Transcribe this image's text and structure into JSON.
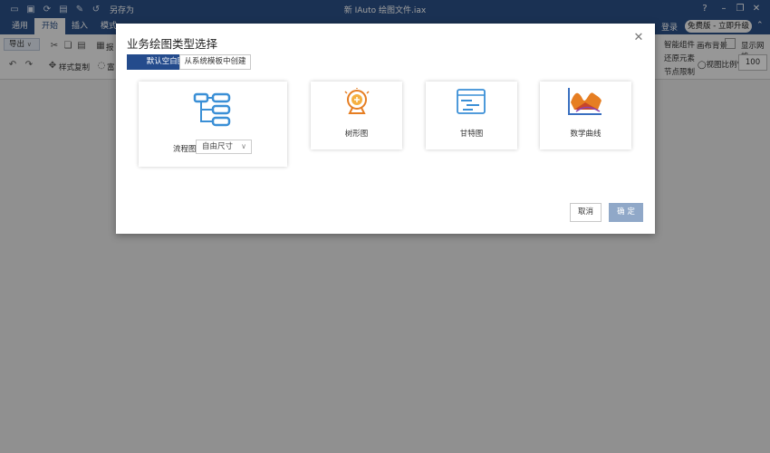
{
  "window": {
    "title": "新 IAuto 绘图文件.iax",
    "save_as": "另存为"
  },
  "menu": {
    "tabs": [
      "通用",
      "开始",
      "插入",
      "模式"
    ],
    "active_index": 1,
    "login": "登录",
    "upgrade": "免费版 - 立即升级"
  },
  "ribbon": {
    "export": "导出",
    "format_painter": "样式复制",
    "right_items": [
      "智能组件",
      "还原元素",
      "节点限制"
    ],
    "canvas_bg": "画布背景",
    "show_grid": "显示网格",
    "zoom_label": "◯视图比例%",
    "zoom_value": "100",
    "truncated_1": "报",
    "truncated_2": "富"
  },
  "dialog": {
    "title": "业务绘图类型选择",
    "tab_blank": "默认空白图",
    "tab_template": "从系统模板中创建",
    "cards": {
      "flowchart": "流程图",
      "tree": "树形图",
      "gantt": "甘特图",
      "math": "数学曲线"
    },
    "size_label": "自由尺寸",
    "cancel": "取消",
    "confirm": "确 定"
  },
  "colors": {
    "brand": "#2b4f86",
    "accent_blue": "#3a8fd6",
    "accent_orange": "#e67e22"
  }
}
